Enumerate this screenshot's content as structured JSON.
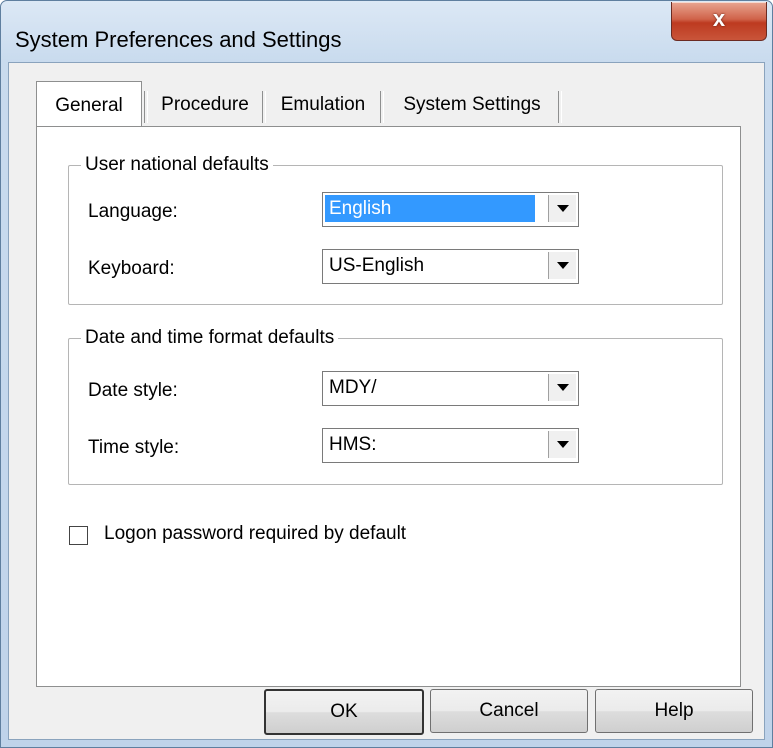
{
  "window": {
    "title": "System Preferences and Settings",
    "close_glyph": "x"
  },
  "tabs": [
    {
      "label": "General",
      "active": true
    },
    {
      "label": "Procedure",
      "active": false
    },
    {
      "label": "Emulation",
      "active": false
    },
    {
      "label": "System Settings",
      "active": false
    }
  ],
  "national_defaults": {
    "title": "User national defaults",
    "language_label": "Language:",
    "language_value": "English",
    "keyboard_label": "Keyboard:",
    "keyboard_value": "US-English"
  },
  "datetime_defaults": {
    "title": "Date and time format defaults",
    "date_label": "Date style:",
    "date_value": "MDY/",
    "time_label": "Time style:",
    "time_value": "HMS:"
  },
  "logon": {
    "label": "Logon password required by default",
    "checked": false
  },
  "buttons": {
    "ok": "OK",
    "cancel": "Cancel",
    "help": "Help"
  },
  "colors": {
    "selection": "#3399ff",
    "close_button": "#c9553a"
  }
}
